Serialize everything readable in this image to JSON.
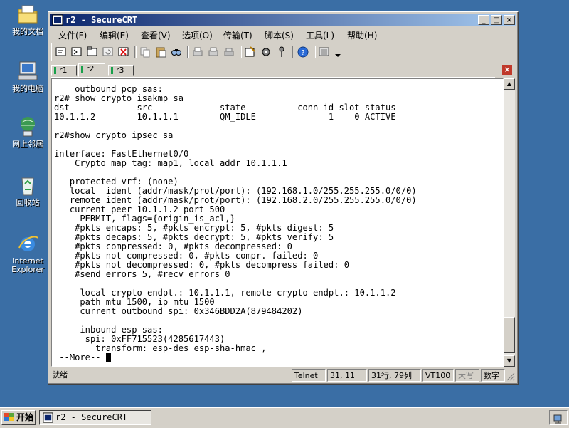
{
  "desktop": {
    "icons": [
      {
        "label": "我的文档",
        "icon": "my-documents-icon"
      },
      {
        "label": "我的电脑",
        "icon": "my-computer-icon"
      },
      {
        "label": "网上邻居",
        "icon": "network-places-icon"
      },
      {
        "label": "回收站",
        "icon": "recycle-bin-icon"
      },
      {
        "label": "Internet Explorer",
        "icon": "internet-explorer-icon"
      }
    ]
  },
  "window": {
    "title": "r2 - SecureCRT",
    "controls": {
      "minimize": "_",
      "maximize": "□",
      "close": "×"
    }
  },
  "menu": [
    "文件(F)",
    "编辑(E)",
    "查看(V)",
    "选项(O)",
    "传输(T)",
    "脚本(S)",
    "工具(L)",
    "帮助(H)"
  ],
  "tabs": [
    {
      "label": "r1",
      "active": false
    },
    {
      "label": "r2",
      "active": true
    },
    {
      "label": "r3",
      "active": false
    }
  ],
  "terminal": {
    "lines": [
      "    outbound pcp sas:",
      "r2# show crypto isakmp sa",
      "dst             src             state          conn-id slot status",
      "10.1.1.2        10.1.1.1        QM_IDLE              1    0 ACTIVE",
      "",
      "r2#show crypto ipsec sa",
      "",
      "interface: FastEthernet0/0",
      "    Crypto map tag: map1, local addr 10.1.1.1",
      "",
      "   protected vrf: (none)",
      "   local  ident (addr/mask/prot/port): (192.168.1.0/255.255.255.0/0/0)",
      "   remote ident (addr/mask/prot/port): (192.168.2.0/255.255.255.0/0/0)",
      "   current_peer 10.1.1.2 port 500",
      "     PERMIT, flags={origin_is_acl,}",
      "    #pkts encaps: 5, #pkts encrypt: 5, #pkts digest: 5",
      "    #pkts decaps: 5, #pkts decrypt: 5, #pkts verify: 5",
      "    #pkts compressed: 0, #pkts decompressed: 0",
      "    #pkts not compressed: 0, #pkts compr. failed: 0",
      "    #pkts not decompressed: 0, #pkts decompress failed: 0",
      "    #send errors 5, #recv errors 0",
      "",
      "     local crypto endpt.: 10.1.1.1, remote crypto endpt.: 10.1.1.2",
      "     path mtu 1500, ip mtu 1500",
      "     current outbound spi: 0x346BDD2A(879484202)",
      "",
      "     inbound esp sas:",
      "      spi: 0xFF715523(4285617443)",
      "        transform: esp-des esp-sha-hmac ,"
    ],
    "prompt": " --More-- "
  },
  "status": {
    "ready": "就绪",
    "protocol": "Telnet",
    "position": "31,  11",
    "rows_cols": "31行, 79列",
    "emulation": "VT100",
    "caps": "大写",
    "num": "数字"
  },
  "taskbar": {
    "start": "开始",
    "task": "r2 - SecureCRT"
  }
}
